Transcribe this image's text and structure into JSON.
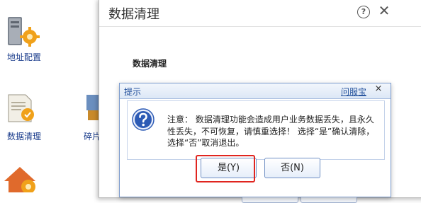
{
  "desktop": {
    "icons": [
      {
        "label": "地址配置"
      },
      {
        "label": "数据清理"
      },
      {
        "label": "碎片"
      }
    ]
  },
  "dialog": {
    "title": "数据清理",
    "heading": "数据清理",
    "help_icon": "help-circle-icon",
    "close_icon": "close-icon"
  },
  "prompt": {
    "title": "提示",
    "help_link": "问服宝",
    "close_glyph": "×",
    "icon": "question-icon",
    "message": "注意： 数据清理功能会造成用户业务数据丢失，且永久性丢失，不可恢复，请慎重选择！ 选择“是”确认清除， 选择“否”取消退出。",
    "yes_label": "是(Y)",
    "no_label": "否(N)"
  },
  "colors": {
    "highlight": "#e0251f",
    "link": "#1f4e9a",
    "icon_blue": "#2d5bb5"
  }
}
